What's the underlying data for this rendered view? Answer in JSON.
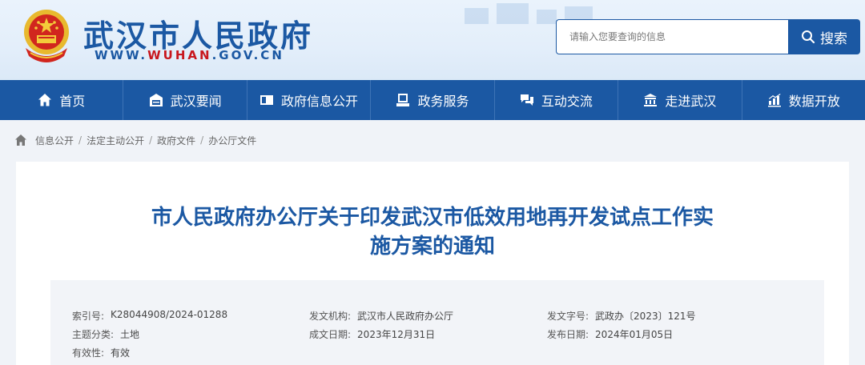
{
  "header": {
    "site_title": "武汉市人民政府",
    "url_prefix": "WWW.",
    "url_highlight": "WUHAN",
    "url_suffix": ".GOV.CN",
    "search_placeholder": "请输入您要查询的信息",
    "search_button": "搜索",
    "colors": {
      "brand": "#1b58a3",
      "accent": "#c8161d"
    }
  },
  "nav": {
    "items": [
      {
        "label": "首页",
        "icon": "home-icon"
      },
      {
        "label": "武汉要闻",
        "icon": "news-icon"
      },
      {
        "label": "政府信息公开",
        "icon": "info-card-icon"
      },
      {
        "label": "政务服务",
        "icon": "service-icon"
      },
      {
        "label": "互动交流",
        "icon": "chat-icon"
      },
      {
        "label": "走进武汉",
        "icon": "building-icon"
      },
      {
        "label": "数据开放",
        "icon": "chart-icon"
      }
    ]
  },
  "breadcrumb": {
    "items": [
      "信息公开",
      "法定主动公开",
      "政府文件",
      "办公厅文件"
    ],
    "separator": "/"
  },
  "article": {
    "title_line1": "市人民政府办公厅关于印发武汉市低效用地再开发试点工作实",
    "title_line2": "施方案的通知",
    "meta": {
      "index_label": "索引号:",
      "index_value": "K28044908/2024-01288",
      "issuer_label": "发文机构:",
      "issuer_value": "武汉市人民政府办公厅",
      "doc_no_label": "发文字号:",
      "doc_no_value": "武政办〔2023〕121号",
      "topic_label": "主题分类:",
      "topic_value": "土地",
      "created_label": "成文日期:",
      "created_value": "2023年12月31日",
      "published_label": "发布日期:",
      "published_value": "2024年01月05日",
      "validity_label": "有效性:",
      "validity_value": "有效"
    }
  }
}
